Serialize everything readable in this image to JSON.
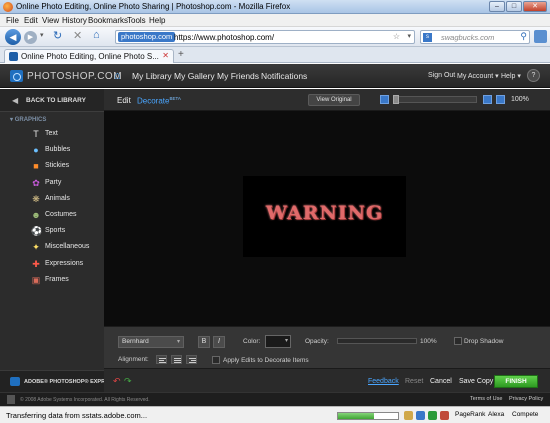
{
  "window": {
    "title": "Online Photo Editing, Online Photo Sharing | Photoshop.com - Mozilla Firefox",
    "controls": [
      "–",
      "□",
      "✕"
    ]
  },
  "menu": [
    "File",
    "Edit",
    "View",
    "History",
    "Bookmarks",
    "Tools",
    "Help"
  ],
  "nav": {
    "site_badge": "photoshop.com",
    "url": "https://www.photoshop.com/",
    "search_placeholder": "swagbucks.com"
  },
  "tab": {
    "label": "Online Photo Editing, Online Photo S...",
    "new_tab": "+"
  },
  "app": {
    "logo_text": "PHOTOSHOP.COM",
    "nav": [
      "My Library",
      "My Gallery",
      "My Friends",
      "Notifications"
    ],
    "right_links": [
      "Sign Out",
      "My Account ▾",
      "Help ▾"
    ],
    "help_glyph": "?"
  },
  "sidebar": {
    "back_label": "BACK TO LIBRARY",
    "section": "GRAPHICS",
    "items": [
      {
        "label": "Text",
        "icon": "text-icon",
        "glyph": "T",
        "color": "#e6e6e6"
      },
      {
        "label": "Bubbles",
        "icon": "bubbles-icon",
        "glyph": "●",
        "color": "#6cc0ff"
      },
      {
        "label": "Stickies",
        "icon": "stickies-icon",
        "glyph": "■",
        "color": "#ff8c2a"
      },
      {
        "label": "Party",
        "icon": "party-icon",
        "glyph": "✿",
        "color": "#c55ad8"
      },
      {
        "label": "Animals",
        "icon": "animals-icon",
        "glyph": "❋",
        "color": "#d8c28a"
      },
      {
        "label": "Costumes",
        "icon": "costumes-icon",
        "glyph": "☻",
        "color": "#9fbf7a"
      },
      {
        "label": "Sports",
        "icon": "sports-icon",
        "glyph": "⚽",
        "color": "#f0f0f0"
      },
      {
        "label": "Miscellaneous",
        "icon": "lightbulb-icon",
        "glyph": "✦",
        "color": "#ffe066"
      },
      {
        "label": "Expressions",
        "icon": "expressions-icon",
        "glyph": "✚",
        "color": "#ff5a4a"
      },
      {
        "label": "Frames",
        "icon": "frames-icon",
        "glyph": "▣",
        "color": "#d96b5a"
      }
    ],
    "product": "ADOBE® PHOTOSHOP® EXPRESS"
  },
  "editor": {
    "tabs": {
      "edit": "Edit",
      "decorate": "Decorate",
      "decorate_badge": "BETA"
    },
    "view_original": "View Original",
    "zoom": "100%",
    "zoom_level": 0
  },
  "canvas": {
    "text": "WARNING",
    "text_color": "#e06a6a"
  },
  "props": {
    "font": "Bernhard",
    "bold": "B",
    "italic": "I",
    "color_label": "Color:",
    "opacity_label": "Opacity:",
    "opacity_value": "100%",
    "drop_shadow": "Drop Shadow",
    "alignment_label": "Alignment:",
    "apply_label": "Apply Edits to Decorate Items"
  },
  "actions": {
    "feedback": "Feedback",
    "reset": "Reset",
    "cancel": "Cancel",
    "save_copy": "Save Copy",
    "finish": "FINISH"
  },
  "footer": {
    "copyright": "© 2008 Adobe Systems Incorporated. All Rights Reserved.",
    "terms": "Terms of Use",
    "privacy": "Privacy Policy"
  },
  "status": {
    "text": "Transferring data from sstats.adobe.com...",
    "progress": 0.6,
    "pagerank": "PageRank",
    "alexa": "Alexa",
    "compete": "Compete"
  },
  "colors": {
    "accent": "#4aa6ff",
    "finish": "#3fa533"
  }
}
